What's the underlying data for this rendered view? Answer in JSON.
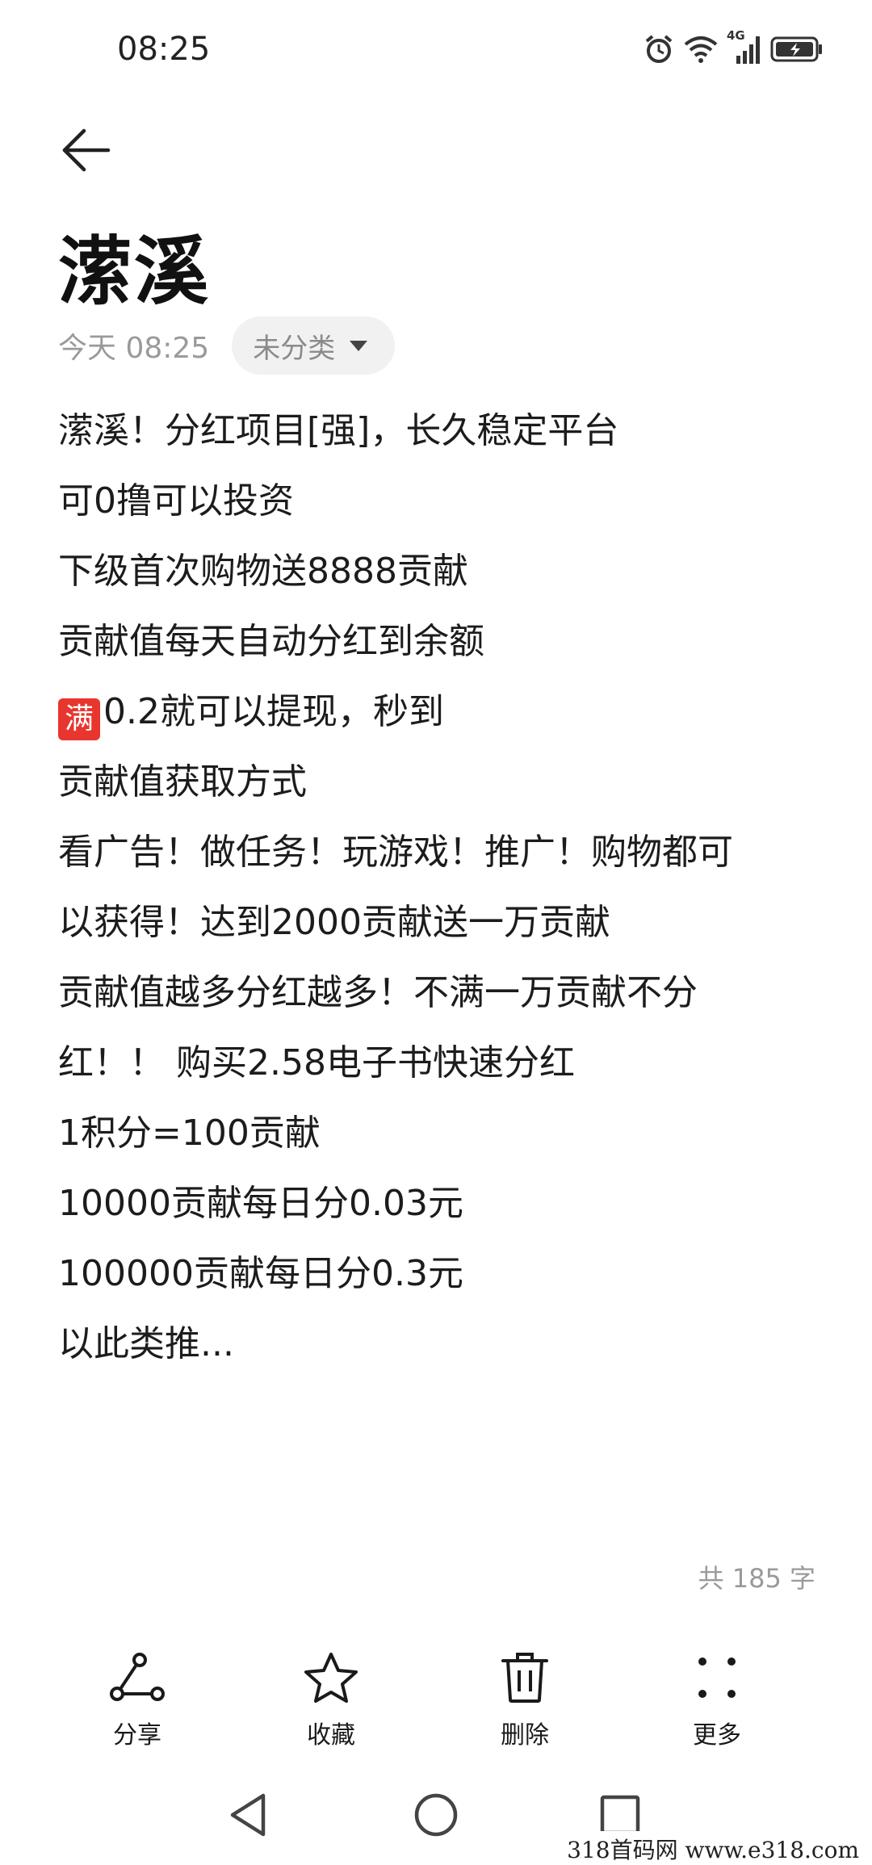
{
  "status_bar": {
    "time": "08:25",
    "network_label": "4G",
    "icons": [
      "alarm-icon",
      "wifi-icon",
      "cellular-signal-icon",
      "battery-charging-icon"
    ]
  },
  "header": {
    "back_icon": "back-arrow-icon",
    "title": "潆溪"
  },
  "meta": {
    "date": "今天 08:25",
    "category": "未分类"
  },
  "body": {
    "lines": [
      "潆溪！分红项目[强]，长久稳定平台",
      "可0撸可以投资",
      "下级首次购物送8888贡献",
      "贡献值每天自动分红到余额",
      "0.2就可以提现，秒到",
      "贡献值获取方式",
      "看广告！做任务！玩游戏！推广！购物都可",
      "以获得！达到2000贡献送一万贡献",
      "贡献值越多分红越多！不满一万贡献不分",
      "红！！ 购买2.58电子书快速分红",
      "1积分=100贡献",
      "10000贡献每日分0.03元",
      "100000贡献每日分0.3元",
      "以此类推..."
    ],
    "emoji_badge": "满"
  },
  "word_count": "共 185 字",
  "toolbar": {
    "share": "分享",
    "favorite": "收藏",
    "delete": "删除",
    "more": "更多"
  },
  "watermark": "318首码网  www.e318.com",
  "colors": {
    "accent_badge": "#e8362f",
    "muted_text": "#9a9a9a",
    "chip_bg": "#f1f1f1"
  }
}
